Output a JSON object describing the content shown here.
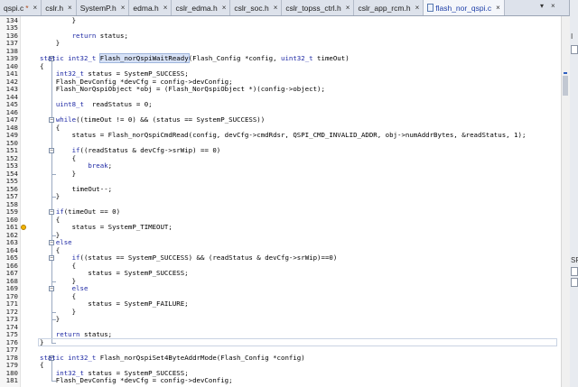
{
  "tabs": [
    {
      "name": "qspi.c",
      "modified": true,
      "active": false
    },
    {
      "name": "cslr.h",
      "modified": false,
      "active": false
    },
    {
      "name": "SystemP.h",
      "modified": false,
      "active": false
    },
    {
      "name": "edma.h",
      "modified": false,
      "active": false
    },
    {
      "name": "cslr_edma.h",
      "modified": false,
      "active": false
    },
    {
      "name": "cslr_soc.h",
      "modified": false,
      "active": false
    },
    {
      "name": "cslr_topss_ctrl.h",
      "modified": false,
      "active": false
    },
    {
      "name": "cslr_app_rcm.h",
      "modified": false,
      "active": false
    },
    {
      "name": "flash_nor_qspi.c",
      "modified": false,
      "active": true
    }
  ],
  "tab_controls": {
    "menu": "▾",
    "close_editor": "×"
  },
  "right_panel": {
    "top_label": "I",
    "side_label": "SF"
  },
  "lines": [
    {
      "num": "134",
      "code": "        }"
    },
    {
      "num": "135",
      "code": ""
    },
    {
      "num": "136",
      "code": "        return status;"
    },
    {
      "num": "137",
      "code": "    }"
    },
    {
      "num": "138",
      "code": ""
    },
    {
      "num": "139",
      "code": "static int32_t Flash_norQspiWaitReady(Flash_Config *config, uint32_t timeOut)"
    },
    {
      "num": "140",
      "code": "{"
    },
    {
      "num": "141",
      "code": "    int32_t status = SystemP_SUCCESS;"
    },
    {
      "num": "142",
      "code": "    Flash_DevConfig *devCfg = config->devConfig;"
    },
    {
      "num": "143",
      "code": "    Flash_NorQspiObject *obj = (Flash_NorQspiObject *)(config->object);"
    },
    {
      "num": "144",
      "code": ""
    },
    {
      "num": "145",
      "code": "    uint8_t  readStatus = 0;"
    },
    {
      "num": "146",
      "code": ""
    },
    {
      "num": "147",
      "code": "    while((timeOut != 0) && (status == SystemP_SUCCESS))"
    },
    {
      "num": "148",
      "code": "    {"
    },
    {
      "num": "149",
      "code": "        status = Flash_norQspiCmdRead(config, devCfg->cmdRdsr, QSPI_CMD_INVALID_ADDR, obj->numAddrBytes, &readStatus, 1);"
    },
    {
      "num": "150",
      "code": ""
    },
    {
      "num": "151",
      "code": "        if((readStatus & devCfg->srWip) == 0)"
    },
    {
      "num": "152",
      "code": "        {"
    },
    {
      "num": "153",
      "code": "            break;"
    },
    {
      "num": "154",
      "code": "        }"
    },
    {
      "num": "155",
      "code": ""
    },
    {
      "num": "156",
      "code": "        timeOut--;"
    },
    {
      "num": "157",
      "code": "    }"
    },
    {
      "num": "158",
      "code": ""
    },
    {
      "num": "159",
      "code": "    if(timeOut == 0)"
    },
    {
      "num": "160",
      "code": "    {"
    },
    {
      "num": "161",
      "code": "        status = SystemP_TIMEOUT;"
    },
    {
      "num": "162",
      "code": "    }"
    },
    {
      "num": "163",
      "code": "    else"
    },
    {
      "num": "164",
      "code": "    {"
    },
    {
      "num": "165",
      "code": "        if((status == SystemP_SUCCESS) && (readStatus & devCfg->srWip)==0)"
    },
    {
      "num": "166",
      "code": "        {"
    },
    {
      "num": "167",
      "code": "            status = SystemP_SUCCESS;"
    },
    {
      "num": "168",
      "code": "        }"
    },
    {
      "num": "169",
      "code": "        else"
    },
    {
      "num": "170",
      "code": "        {"
    },
    {
      "num": "171",
      "code": "            status = SystemP_FAILURE;"
    },
    {
      "num": "172",
      "code": "        }"
    },
    {
      "num": "173",
      "code": "    }"
    },
    {
      "num": "174",
      "code": ""
    },
    {
      "num": "175",
      "code": "    return status;"
    },
    {
      "num": "176",
      "code": "}"
    },
    {
      "num": "177",
      "code": ""
    },
    {
      "num": "178",
      "code": "static int32_t Flash_norQspiSet4ByteAddrMode(Flash_Config *config)"
    },
    {
      "num": "179",
      "code": "{"
    },
    {
      "num": "180",
      "code": "    int32_t status = SystemP_SUCCESS;"
    },
    {
      "num": "181",
      "code": "    Flash_DevConfig *devCfg = config->devConfig;"
    }
  ],
  "highlighted_identifier": "Flash_norQspiWaitReady",
  "breakpoint_line": "161",
  "current_line": "176",
  "colors": {
    "keyword": "#1f2aa5",
    "active_tab": "#1e3fa8",
    "highlight": "#d7e2f7"
  }
}
